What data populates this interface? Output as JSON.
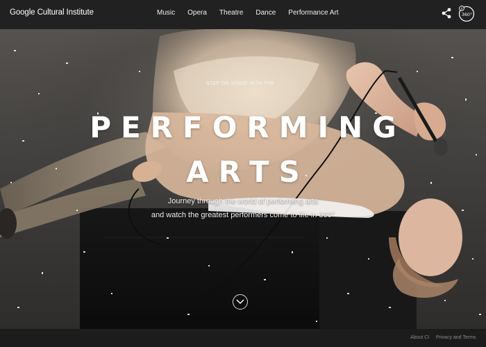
{
  "header": {
    "brand": "Google Cultural Institute",
    "nav": [
      "Music",
      "Opera",
      "Theatre",
      "Dance",
      "Performance Art"
    ],
    "share_icon": "share-icon",
    "vr_badge_text": "360°"
  },
  "hero": {
    "eyebrow": "STEP ON STAGE WITH THE",
    "title_line1": "PERFORMING",
    "title_line2": "ARTS",
    "subtitle_line1": "Journey through the world of performing arts",
    "subtitle_line2": "and watch the greatest performers come to life in 360°",
    "scroll_icon": "chevron-down-icon"
  },
  "footer": {
    "about": "About CI",
    "terms": "Privacy and Terms"
  },
  "colors": {
    "topbar": "#212121",
    "footer": "#1c1c1c",
    "text": "#ffffff"
  }
}
